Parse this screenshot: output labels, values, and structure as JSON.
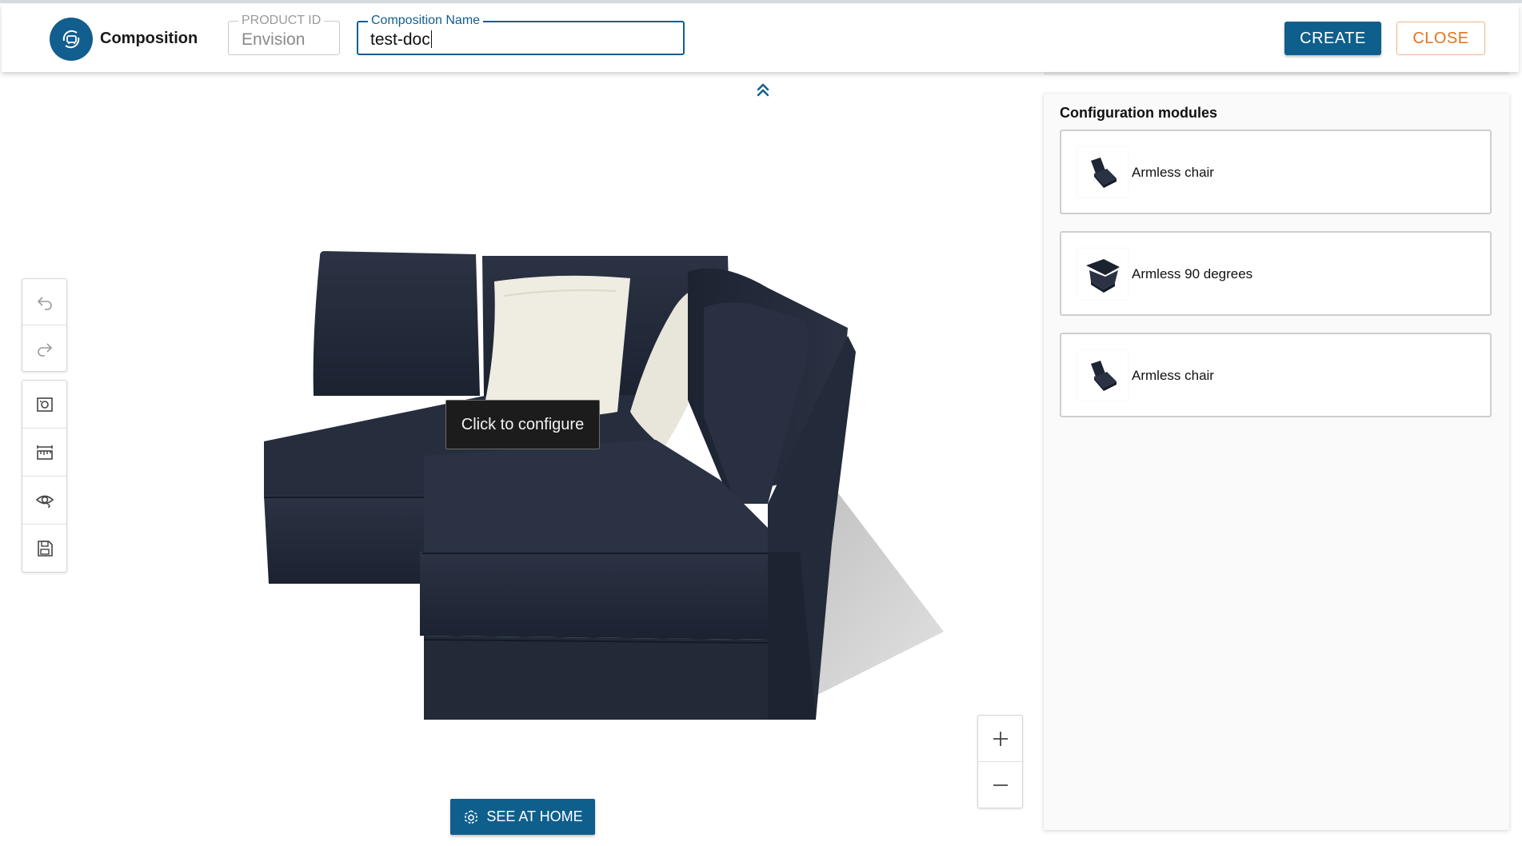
{
  "header": {
    "app_title": "Composition",
    "product_id": {
      "label": "PRODUCT ID",
      "value": "Envision"
    },
    "composition_name": {
      "label": "Composition Name",
      "value": "test-doc"
    },
    "create_label": "CREATE",
    "close_label": "CLOSE"
  },
  "toolbar": {
    "tools": [
      "undo-icon",
      "redo-icon",
      "screenshot-icon",
      "measure-icon",
      "visibility-icon",
      "save-icon"
    ]
  },
  "viewer": {
    "tooltip": "Click to configure",
    "see_at_home_label": "SEE AT HOME",
    "zoom_in_symbol": "+",
    "zoom_out_symbol": "–"
  },
  "panel": {
    "title": "Configuration modules",
    "modules": [
      {
        "label": "Armless chair",
        "icon": "armless-chair-icon"
      },
      {
        "label": "Armless 90 degrees",
        "icon": "armless-corner-icon"
      },
      {
        "label": "Armless chair",
        "icon": "armless-chair-icon"
      }
    ]
  },
  "colors": {
    "primary": "#0f5f8d",
    "close_accent": "#e3731f",
    "sofa_fabric": "#222a38",
    "pillow": "#efece2"
  }
}
